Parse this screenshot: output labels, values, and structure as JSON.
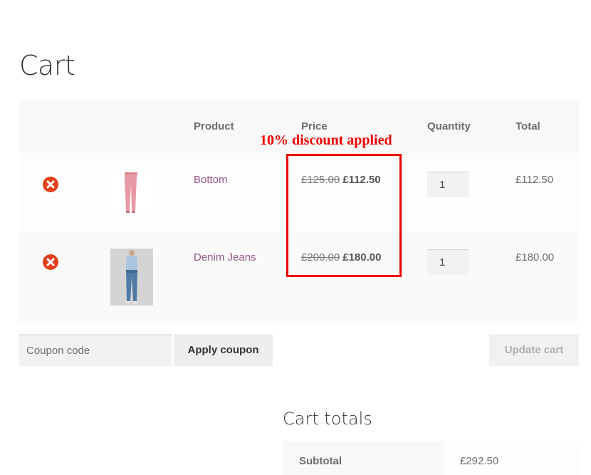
{
  "page": {
    "title": "Cart"
  },
  "table": {
    "headers": {
      "product": "Product",
      "price": "Price",
      "quantity": "Quantity",
      "total": "Total"
    }
  },
  "annotation": {
    "text": "10% discount applied",
    "color": "#ee0000"
  },
  "items": [
    {
      "name": "Bottom",
      "original_price": "£125.00",
      "sale_price": "£112.50",
      "quantity": "1",
      "total": "£112.50",
      "image": "pink-trousers"
    },
    {
      "name": "Denim Jeans",
      "original_price": "£200.00",
      "sale_price": "£180.00",
      "quantity": "1",
      "total": "£180.00",
      "image": "blue-jeans"
    }
  ],
  "coupon": {
    "placeholder": "Coupon code",
    "apply_label": "Apply coupon"
  },
  "update_label": "Update cart",
  "totals": {
    "title": "Cart totals",
    "subtotal_label": "Subtotal",
    "subtotal_value": "£292.50"
  },
  "colors": {
    "link": "#96588a",
    "remove": "#e2401c"
  }
}
